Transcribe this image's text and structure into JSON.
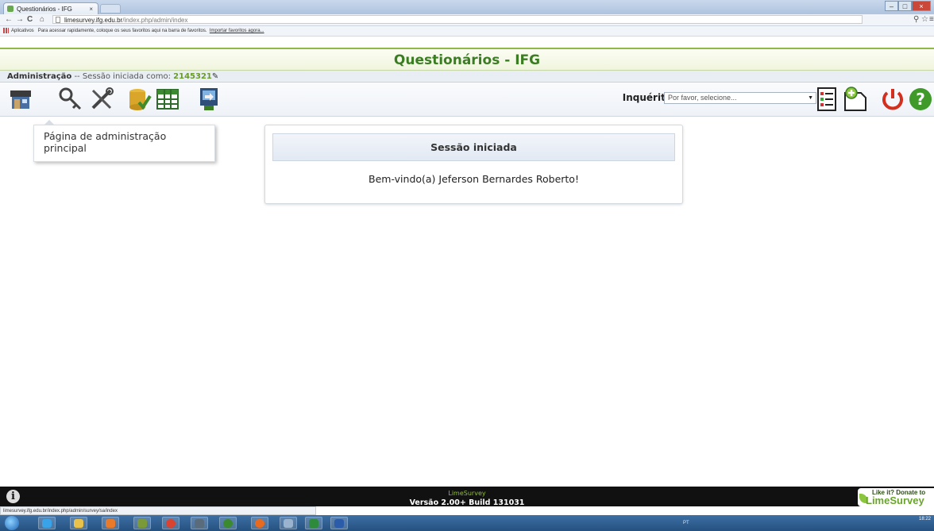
{
  "browser": {
    "tab_title": "Questionários - IFG",
    "tab_close": "×",
    "url_host": "limesurvey.ifg.edu.br",
    "url_path": "/index.php/admin/index",
    "bookmarks_apps": "Aplicativos",
    "bookmarks_hint": "Para acessar rapidamente, coloque os seus favoritos aqui na barra de favoritos.",
    "bookmarks_import": "Importar favoritos agora...",
    "status_url": "limesurvey.ifg.edu.br/index.php/admin/survey/sa/index"
  },
  "header": {
    "title": "Questionários - IFG"
  },
  "adminbar": {
    "label": "Administração",
    "session_text": "-- Sessão iniciada como:",
    "username": "2145321"
  },
  "toolbar": {
    "surveys_label": "Inquéritos:",
    "survey_select_placeholder": "Por favor, selecione...",
    "icons": [
      "home-icon",
      "key-icon",
      "tools-icon",
      "database-icon",
      "grid-icon",
      "export-icon",
      "survey-list-icon",
      "new-survey-icon",
      "logout-icon",
      "help-icon"
    ]
  },
  "tooltip": {
    "text": "Página de administração principal"
  },
  "welcome": {
    "heading": "Sessão iniciada",
    "message": "Bem-vindo(a) Jeferson Bernardes Roberto!"
  },
  "footer": {
    "brand": "LimeSurvey",
    "version": "Versão 2.00+ Build 131031",
    "donate_line1": "Like it? Donate to",
    "donate_line2": "LimeSurvey"
  },
  "taskbar": {
    "tray_lang": "PT",
    "clock_time": "18:22"
  },
  "colors": {
    "brand_green": "#3b7d23",
    "accent_green": "#6a9a2c",
    "footer_bg": "#111111"
  }
}
